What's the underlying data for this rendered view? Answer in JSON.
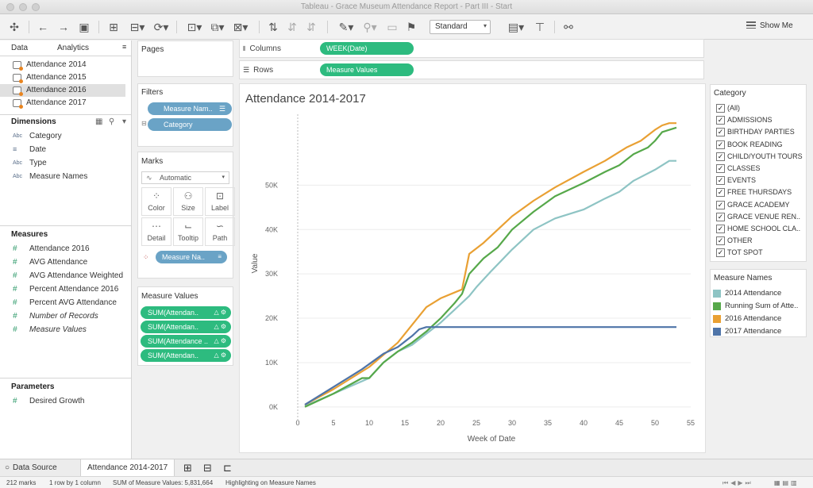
{
  "window": {
    "title": "Tableau - Grace Museum Attendance Report - Part III - Start"
  },
  "toolbar": {
    "standard_label": "Standard",
    "show_me_label": "Show Me"
  },
  "data_pane": {
    "tabs": [
      "Data",
      "Analytics"
    ],
    "data_sources": [
      "Attendance 2014",
      "Attendance 2015",
      "Attendance 2016",
      "Attendance 2017"
    ],
    "selected_source_index": 2,
    "dimensions_header": "Dimensions",
    "dimensions": [
      {
        "type": "Abc",
        "name": "Category"
      },
      {
        "type": "date",
        "name": "Date"
      },
      {
        "type": "Abc",
        "name": "Type"
      },
      {
        "type": "Abc",
        "name": "Measure Names"
      }
    ],
    "measures_header": "Measures",
    "measures": [
      {
        "name": "Attendance 2016",
        "italic": false
      },
      {
        "name": "AVG Attendance",
        "italic": false
      },
      {
        "name": "AVG Attendance Weighted",
        "italic": false
      },
      {
        "name": "Percent Attendance 2016",
        "italic": false
      },
      {
        "name": "Percent AVG Attendance",
        "italic": false
      },
      {
        "name": "Number of Records",
        "italic": true
      },
      {
        "name": "Measure Values",
        "italic": true
      }
    ],
    "parameters_header": "Parameters",
    "parameters": [
      "Desired Growth"
    ]
  },
  "pages_card": {
    "title": "Pages"
  },
  "filters_card": {
    "title": "Filters",
    "pills": [
      "Measure Nam..",
      "Category"
    ]
  },
  "marks_card": {
    "title": "Marks",
    "mark_type": "Automatic",
    "buttons": [
      "Color",
      "Size",
      "Label",
      "Detail",
      "Tooltip",
      "Path"
    ],
    "pill": "Measure Na.."
  },
  "measure_values_card": {
    "title": "Measure Values",
    "pills": [
      "SUM(Attendan..",
      "SUM(Attendan..",
      "SUM(Attendance ..",
      "SUM(Attendan.."
    ]
  },
  "shelves": {
    "columns_label": "Columns",
    "columns_pill": "WEEK(Date)",
    "rows_label": "Rows",
    "rows_pill": "Measure Values"
  },
  "chart_data": {
    "type": "line",
    "title": "Attendance 2014-2017",
    "xlabel": "Week of Date",
    "ylabel": "Value",
    "xlim": [
      0,
      55
    ],
    "ylim": [
      -2000,
      66000
    ],
    "x_ticks": [
      0,
      5,
      10,
      15,
      20,
      25,
      30,
      35,
      40,
      45,
      50,
      55
    ],
    "y_ticks": [
      0,
      10000,
      20000,
      30000,
      40000,
      50000
    ],
    "y_tick_labels": [
      "0K",
      "10K",
      "20K",
      "30K",
      "40K",
      "50K"
    ],
    "grid": "horizontal",
    "series": [
      {
        "name": "2014 Attendance",
        "color": "#8ec4c4",
        "x": [
          1,
          5,
          10,
          12,
          14,
          16,
          18,
          20,
          22,
          24,
          25,
          27,
          30,
          33,
          36,
          40,
          43,
          45,
          47,
          50,
          52,
          53
        ],
        "y": [
          200,
          3000,
          6500,
          10000,
          12500,
          14000,
          16500,
          19000,
          22000,
          25000,
          27000,
          30500,
          35500,
          40000,
          42500,
          44500,
          47000,
          48500,
          51000,
          53500,
          55500,
          55500
        ]
      },
      {
        "name": "Running Sum of Attendance",
        "color": "#56a84a",
        "x": [
          1,
          5,
          9,
          10,
          12,
          14,
          16,
          18,
          20,
          22,
          23,
          24,
          26,
          28,
          30,
          33,
          36,
          40,
          43,
          45,
          47,
          49,
          50,
          51,
          53
        ],
        "y": [
          0,
          3000,
          6500,
          6500,
          10000,
          12500,
          14500,
          17000,
          20000,
          23500,
          25500,
          30000,
          33500,
          36000,
          40000,
          44000,
          47500,
          50500,
          53000,
          54500,
          57000,
          58500,
          60000,
          62000,
          63000
        ]
      },
      {
        "name": "2016 Attendance",
        "color": "#e9a033",
        "x": [
          1,
          5,
          10,
          14,
          16,
          18,
          20,
          23,
          24,
          26,
          28,
          30,
          33,
          36,
          40,
          43,
          46,
          48,
          50,
          51,
          52,
          53
        ],
        "y": [
          500,
          4000,
          9000,
          14500,
          18500,
          22500,
          24500,
          26500,
          34500,
          37000,
          40000,
          43000,
          46500,
          49500,
          53000,
          55500,
          58500,
          60000,
          62500,
          63500,
          64000,
          64000
        ]
      },
      {
        "name": "2017 Attendance",
        "color": "#4e74a8",
        "x": [
          1,
          5,
          9,
          12,
          14,
          16,
          17,
          18,
          53
        ],
        "y": [
          500,
          4500,
          8500,
          12000,
          13500,
          16000,
          17500,
          18000,
          18000
        ]
      }
    ]
  },
  "category_legend": {
    "title": "Category",
    "items": [
      "(All)",
      "ADMISSIONS",
      "BIRTHDAY PARTIES",
      "BOOK READING",
      "CHILD/YOUTH TOURS",
      "CLASSES",
      "EVENTS",
      "FREE THURSDAYS",
      "GRACE ACADEMY",
      "GRACE VENUE REN..",
      "HOME SCHOOL CLA..",
      "OTHER",
      "TOT SPOT"
    ]
  },
  "measure_names_legend": {
    "title": "Measure Names",
    "items": [
      {
        "label": "2014 Attendance",
        "color": "#8ec4c4"
      },
      {
        "label": "Running Sum of Atte..",
        "color": "#56a84a"
      },
      {
        "label": "2016 Attendance",
        "color": "#e9a033"
      },
      {
        "label": "2017 Attendance",
        "color": "#4e74a8"
      }
    ]
  },
  "sheet_tabs": {
    "data_source": "Data Source",
    "active_sheet": "Attendance 2014-2017"
  },
  "status_bar": {
    "marks": "212 marks",
    "dims": "1 row by 1 column",
    "sum": "SUM of Measure Values: 5,831,664",
    "highlight": "Highlighting on Measure Names"
  }
}
